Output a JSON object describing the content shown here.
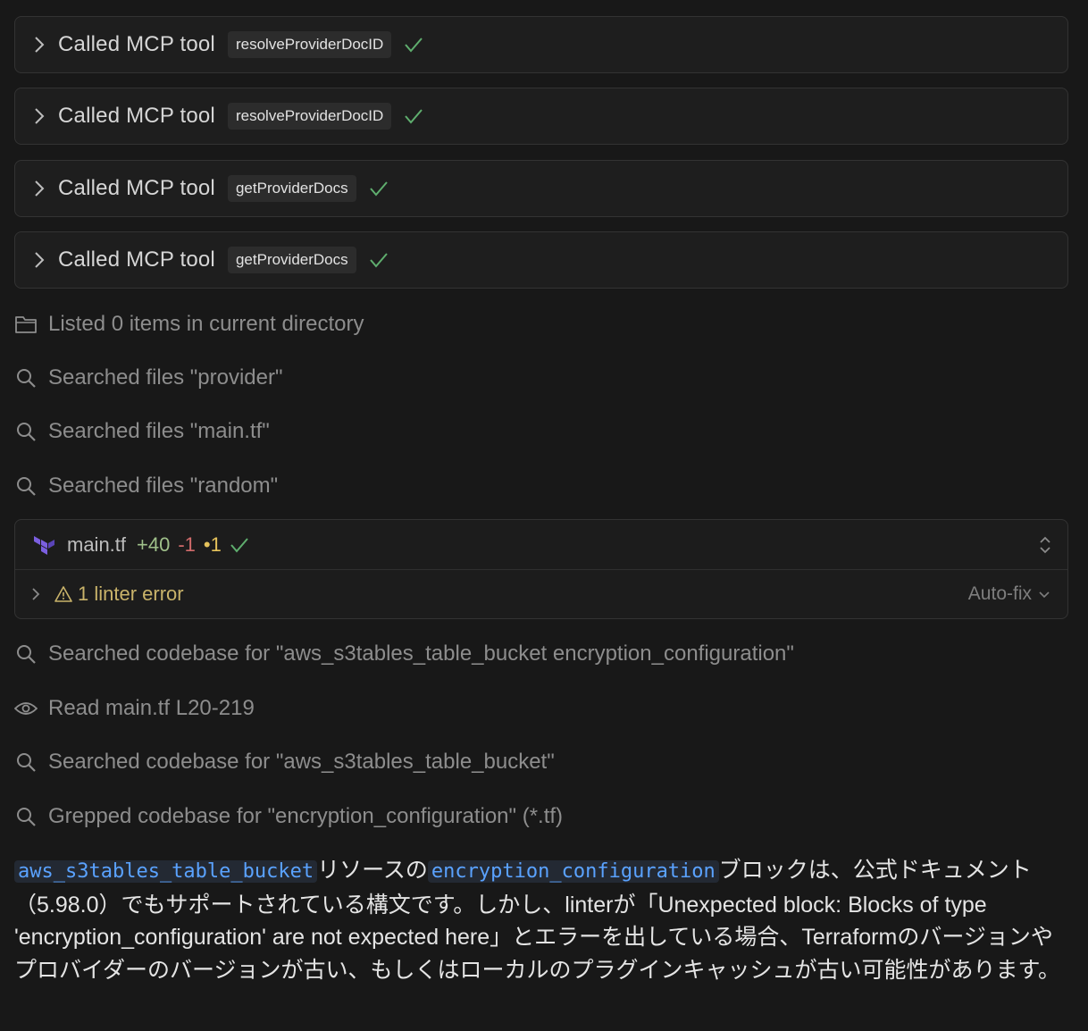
{
  "tool_calls": [
    {
      "label": "Called MCP tool",
      "tool": "resolveProviderDocID"
    },
    {
      "label": "Called MCP tool",
      "tool": "resolveProviderDocID"
    },
    {
      "label": "Called MCP tool",
      "tool": "getProviderDocs"
    },
    {
      "label": "Called MCP tool",
      "tool": "getProviderDocs"
    }
  ],
  "activities_top": [
    {
      "icon": "folder-icon",
      "text": "Listed 0 items in current directory"
    },
    {
      "icon": "search-icon",
      "text": "Searched files \"provider\""
    },
    {
      "icon": "search-icon",
      "text": "Searched files \"main.tf\""
    },
    {
      "icon": "search-icon",
      "text": "Searched files \"random\""
    }
  ],
  "file_change": {
    "icon": "terraform-icon",
    "filename": "main.tf",
    "added": "+40",
    "removed": "-1",
    "modified": "•1",
    "lint_text": "1 linter error",
    "autofix_label": "Auto-fix"
  },
  "activities_bottom": [
    {
      "icon": "search-icon",
      "text": "Searched codebase for \"aws_s3tables_table_bucket encryption_configuration\""
    },
    {
      "icon": "eye-icon",
      "text": "Read main.tf L20-219"
    },
    {
      "icon": "search-icon",
      "text": "Searched codebase for \"aws_s3tables_table_bucket\""
    },
    {
      "icon": "search-icon",
      "text": "Grepped codebase for \"encryption_configuration\" (*.tf)"
    }
  ],
  "answer": {
    "code1": "aws_s3tables_table_bucket",
    "text1": "リソースの",
    "code2": "encryption_configuration",
    "text2": "ブロックは、公式ドキュメント（5.98.0）でもサポートされている構文です。しかし、linterが「Unexpected block: Blocks of type 'encryption_configuration' are not expected here」とエラーを出している場合、Terraformのバージョンやプロバイダーのバージョンが古い、もしくはローカルのプラグインキャッシュが古い可能性があります。"
  },
  "colors": {
    "background": "#181818",
    "check": "#5fae6e",
    "added": "#9fc08a",
    "removed": "#d16b6b",
    "modified": "#e6c35c",
    "code": "#5aa2ff"
  }
}
